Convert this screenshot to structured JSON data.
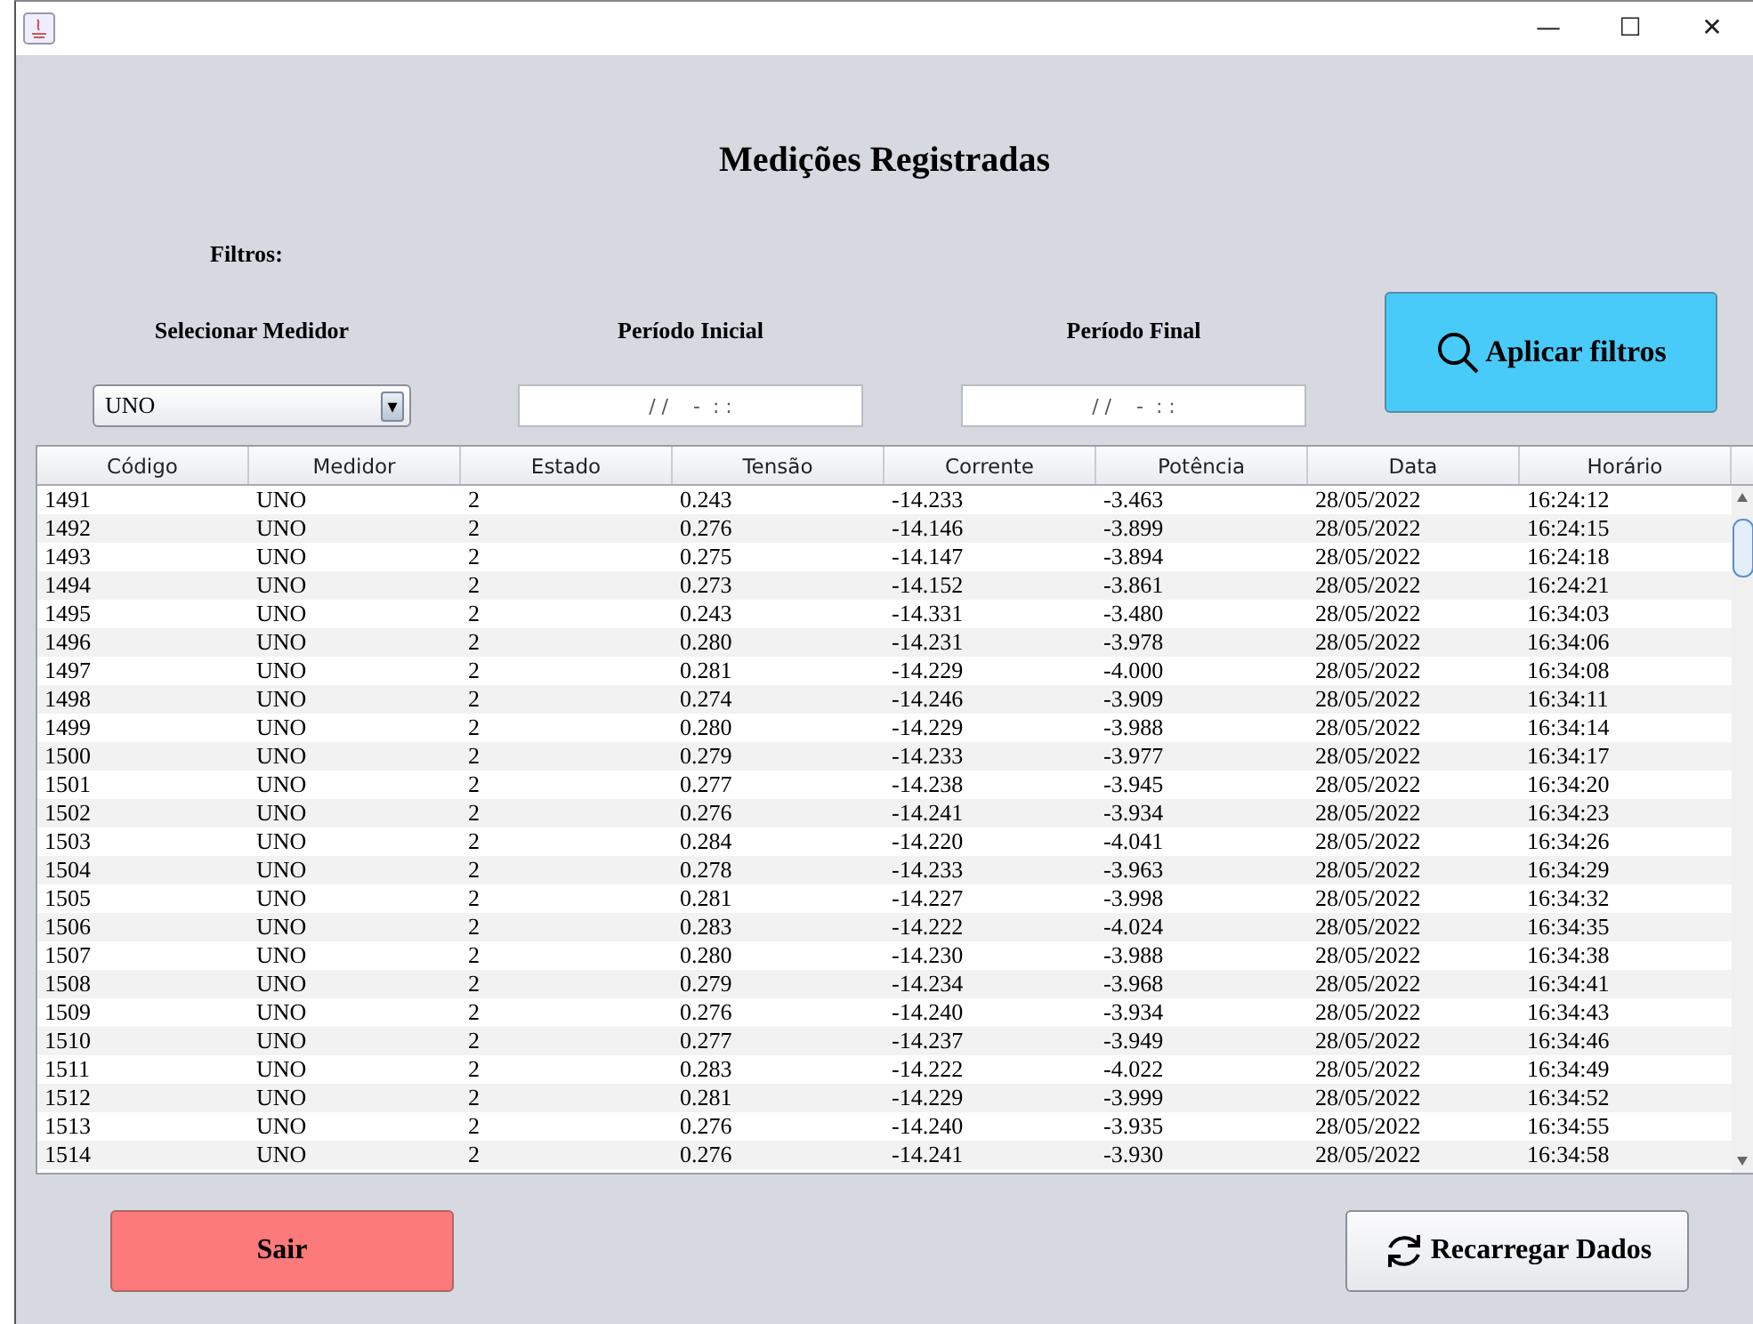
{
  "window": {
    "title_buttons": [
      "—",
      "☐",
      "✕"
    ]
  },
  "title": "Medições Registradas",
  "filters": {
    "heading": "Filtros:",
    "meter": {
      "label": "Selecionar Medidor",
      "value": "UNO",
      "arrow": "▾"
    },
    "start": {
      "label": "Período Inicial",
      "value": "/ /    -  : :"
    },
    "end": {
      "label": "Período Final",
      "value": "/ /    -  : :"
    },
    "apply_button": "Aplicar filtros"
  },
  "table": {
    "columns": [
      "Código",
      "Medidor",
      "Estado",
      "Tensão",
      "Corrente",
      "Potência",
      "Data",
      "Horário"
    ],
    "rows": [
      [
        "1491",
        "UNO",
        "2",
        "0.243",
        "-14.233",
        "-3.463",
        "28/05/2022",
        "16:24:12"
      ],
      [
        "1492",
        "UNO",
        "2",
        "0.276",
        "-14.146",
        "-3.899",
        "28/05/2022",
        "16:24:15"
      ],
      [
        "1493",
        "UNO",
        "2",
        "0.275",
        "-14.147",
        "-3.894",
        "28/05/2022",
        "16:24:18"
      ],
      [
        "1494",
        "UNO",
        "2",
        "0.273",
        "-14.152",
        "-3.861",
        "28/05/2022",
        "16:24:21"
      ],
      [
        "1495",
        "UNO",
        "2",
        "0.243",
        "-14.331",
        "-3.480",
        "28/05/2022",
        "16:34:03"
      ],
      [
        "1496",
        "UNO",
        "2",
        "0.280",
        "-14.231",
        "-3.978",
        "28/05/2022",
        "16:34:06"
      ],
      [
        "1497",
        "UNO",
        "2",
        "0.281",
        "-14.229",
        "-4.000",
        "28/05/2022",
        "16:34:08"
      ],
      [
        "1498",
        "UNO",
        "2",
        "0.274",
        "-14.246",
        "-3.909",
        "28/05/2022",
        "16:34:11"
      ],
      [
        "1499",
        "UNO",
        "2",
        "0.280",
        "-14.229",
        "-3.988",
        "28/05/2022",
        "16:34:14"
      ],
      [
        "1500",
        "UNO",
        "2",
        "0.279",
        "-14.233",
        "-3.977",
        "28/05/2022",
        "16:34:17"
      ],
      [
        "1501",
        "UNO",
        "2",
        "0.277",
        "-14.238",
        "-3.945",
        "28/05/2022",
        "16:34:20"
      ],
      [
        "1502",
        "UNO",
        "2",
        "0.276",
        "-14.241",
        "-3.934",
        "28/05/2022",
        "16:34:23"
      ],
      [
        "1503",
        "UNO",
        "2",
        "0.284",
        "-14.220",
        "-4.041",
        "28/05/2022",
        "16:34:26"
      ],
      [
        "1504",
        "UNO",
        "2",
        "0.278",
        "-14.233",
        "-3.963",
        "28/05/2022",
        "16:34:29"
      ],
      [
        "1505",
        "UNO",
        "2",
        "0.281",
        "-14.227",
        "-3.998",
        "28/05/2022",
        "16:34:32"
      ],
      [
        "1506",
        "UNO",
        "2",
        "0.283",
        "-14.222",
        "-4.024",
        "28/05/2022",
        "16:34:35"
      ],
      [
        "1507",
        "UNO",
        "2",
        "0.280",
        "-14.230",
        "-3.988",
        "28/05/2022",
        "16:34:38"
      ],
      [
        "1508",
        "UNO",
        "2",
        "0.279",
        "-14.234",
        "-3.968",
        "28/05/2022",
        "16:34:41"
      ],
      [
        "1509",
        "UNO",
        "2",
        "0.276",
        "-14.240",
        "-3.934",
        "28/05/2022",
        "16:34:43"
      ],
      [
        "1510",
        "UNO",
        "2",
        "0.277",
        "-14.237",
        "-3.949",
        "28/05/2022",
        "16:34:46"
      ],
      [
        "1511",
        "UNO",
        "2",
        "0.283",
        "-14.222",
        "-4.022",
        "28/05/2022",
        "16:34:49"
      ],
      [
        "1512",
        "UNO",
        "2",
        "0.281",
        "-14.229",
        "-3.999",
        "28/05/2022",
        "16:34:52"
      ],
      [
        "1513",
        "UNO",
        "2",
        "0.276",
        "-14.240",
        "-3.935",
        "28/05/2022",
        "16:34:55"
      ],
      [
        "1514",
        "UNO",
        "2",
        "0.276",
        "-14.241",
        "-3.930",
        "28/05/2022",
        "16:34:58"
      ]
    ]
  },
  "buttons": {
    "exit": "Sair",
    "reload": "Recarregar Dados"
  }
}
